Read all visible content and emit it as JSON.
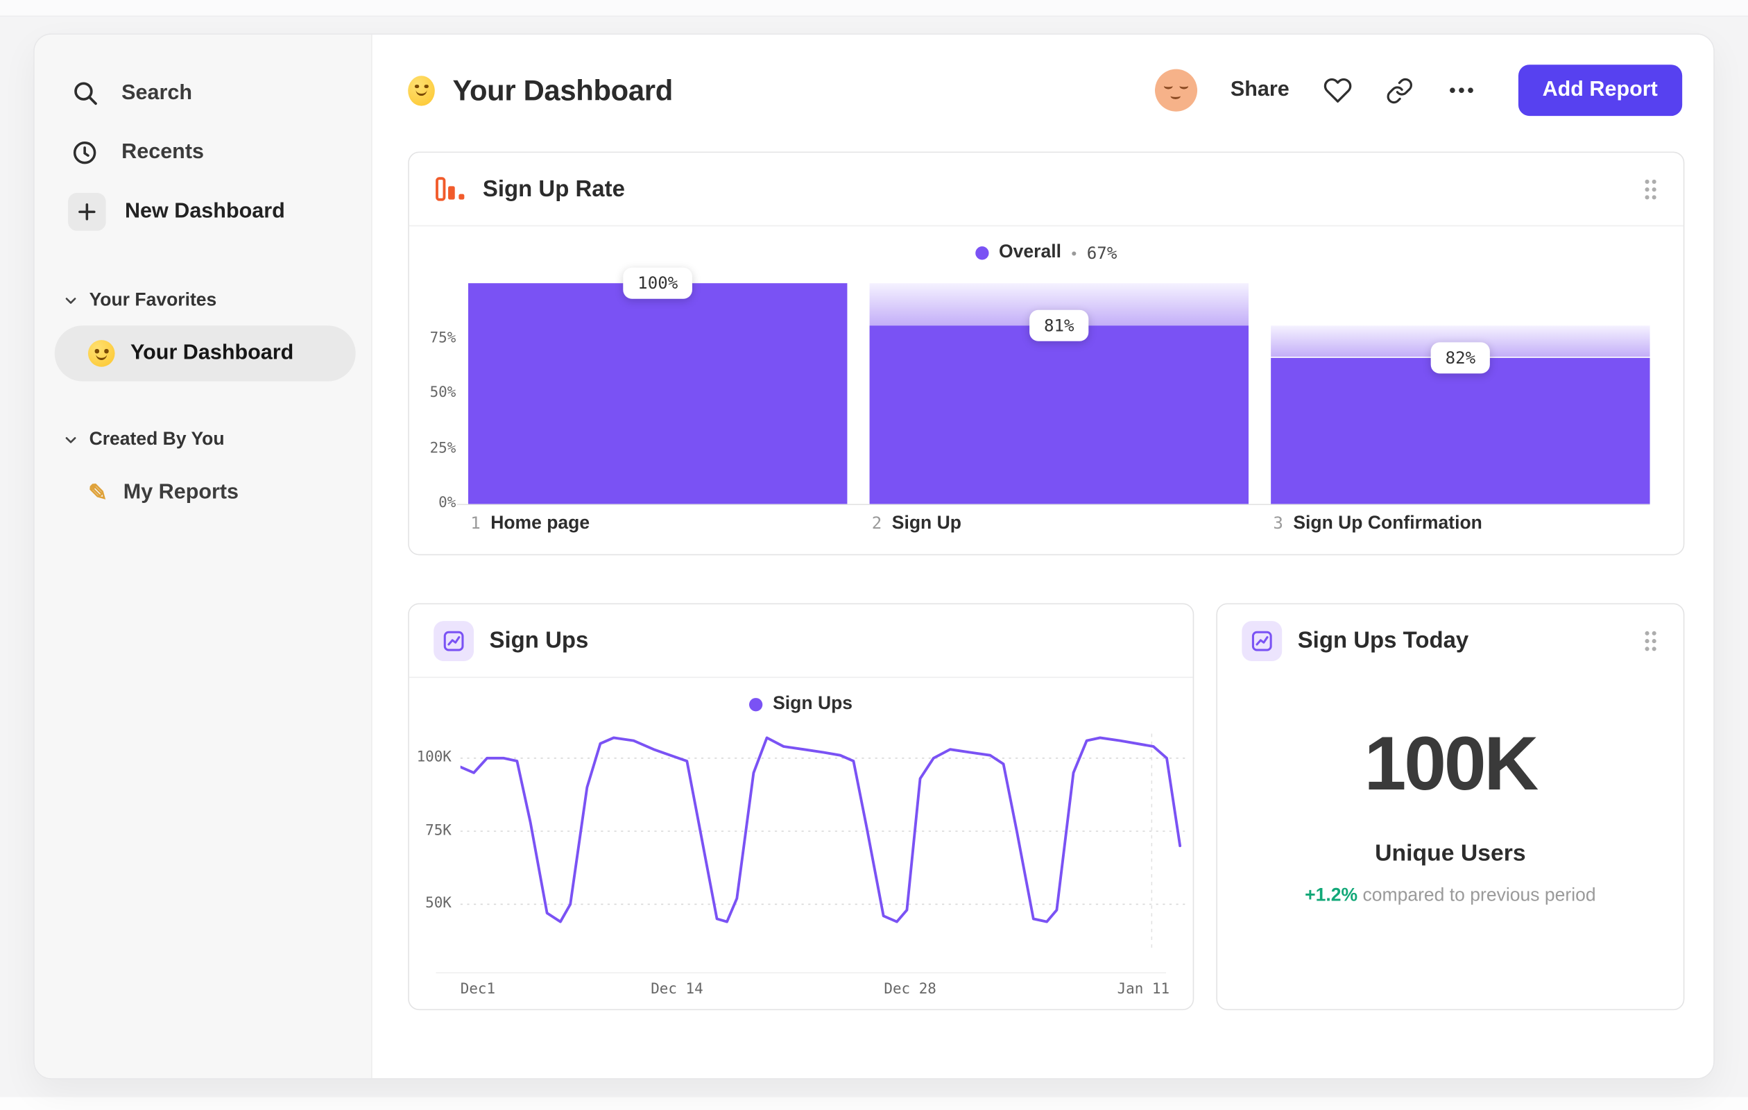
{
  "colors": {
    "accent_purple": "#7a52f4",
    "button_purple": "#5741f0",
    "icon_orange": "#f15b2b",
    "positive_green": "#12a878",
    "icon_bg_purple": "#ece4fd"
  },
  "sidebar": {
    "nav": [
      {
        "label": "Search",
        "icon": "search-icon"
      },
      {
        "label": "Recents",
        "icon": "clock-icon"
      },
      {
        "label": "New Dashboard",
        "icon": "plus-icon"
      }
    ],
    "sections": [
      {
        "title": "Your Favorites",
        "items": [
          {
            "label": "Your Dashboard",
            "icon": "smiley-emoji",
            "selected": true
          }
        ]
      },
      {
        "title": "Created By You",
        "items": [
          {
            "label": "My Reports",
            "icon": "pencil-emoji",
            "selected": false
          }
        ]
      }
    ]
  },
  "header": {
    "title": "Your Dashboard",
    "share_label": "Share",
    "add_report_label": "Add Report"
  },
  "chart_data": [
    {
      "type": "bar",
      "subtype": "funnel",
      "title": "Sign Up Rate",
      "legend": {
        "label": "Overall",
        "separator": "•",
        "value": "67%"
      },
      "ylim": [
        0,
        100
      ],
      "yticks": [
        75,
        50,
        25,
        0
      ],
      "ytick_labels": [
        "75%",
        "50%",
        "25%",
        "0%"
      ],
      "steps": [
        {
          "index": "1",
          "label": "Home page",
          "step_pct": 100,
          "cumulative_pct": 100
        },
        {
          "index": "2",
          "label": "Sign Up",
          "step_pct": 81,
          "cumulative_pct": 81
        },
        {
          "index": "3",
          "label": "Sign Up Confirmation",
          "step_pct": 82,
          "cumulative_pct": 66.4
        }
      ]
    },
    {
      "type": "line",
      "title": "Sign Ups",
      "legend": {
        "label": "Sign Ups"
      },
      "yticks": [
        100,
        75,
        50
      ],
      "ytick_labels": [
        "100K",
        "75K",
        "50K"
      ],
      "xtick_labels": [
        "Dec1",
        "Dec 14",
        "Dec 28",
        "Jan 11"
      ],
      "xtick_days": [
        0,
        13,
        27,
        41
      ],
      "x_domain_days": [
        0,
        43.5
      ],
      "y_unit": "K",
      "grid": "dotted-horizontal",
      "legend_position": "top-center",
      "series": [
        {
          "name": "Sign Ups",
          "x_days": [
            0,
            0.8,
            1.6,
            2.6,
            3.4,
            4.2,
            5.2,
            6,
            6.6,
            7.6,
            8.4,
            9.2,
            10.4,
            11.6,
            12.6,
            13.6,
            14.4,
            15.4,
            16,
            16.6,
            17.6,
            18.4,
            19.4,
            20.6,
            21.8,
            22.8,
            23.6,
            24.4,
            25.4,
            26.2,
            26.8,
            27.6,
            28.4,
            29.4,
            30.6,
            31.8,
            32.6,
            33.4,
            34.4,
            35.2,
            35.8,
            36.8,
            37.6,
            38.4,
            39.6,
            40.6,
            41.6,
            42.4,
            43.2
          ],
          "y_values_k": [
            97,
            95,
            100,
            100,
            99,
            78,
            47,
            44,
            50,
            90,
            105,
            107,
            106,
            103,
            101,
            99,
            75,
            45,
            44,
            52,
            95,
            107,
            104,
            103,
            102,
            101,
            99,
            76,
            46,
            44,
            48,
            93,
            100,
            103,
            102,
            101,
            98,
            75,
            45,
            44,
            48,
            95,
            106,
            107,
            106,
            105,
            104,
            100,
            70
          ]
        }
      ]
    },
    {
      "type": "kpi",
      "title": "Sign Ups Today",
      "value": "100K",
      "label": "Unique Users",
      "delta_pct": "+1.2%",
      "comparison": "compared to previous period"
    }
  ]
}
